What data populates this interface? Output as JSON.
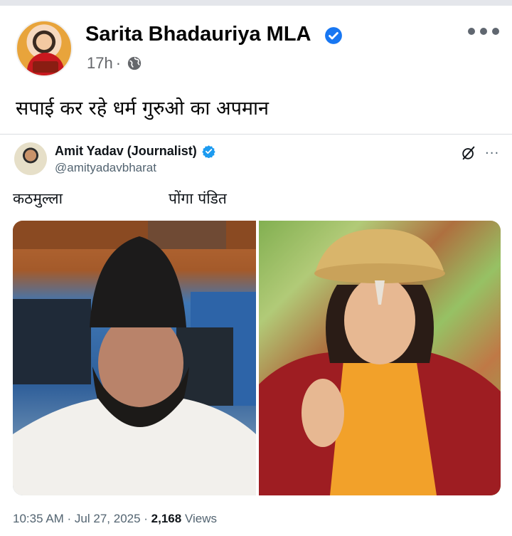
{
  "post": {
    "author_name": "Sarita Bhadauriya MLA",
    "time": "17h",
    "separator": "·",
    "audience_icon": "globe-icon",
    "text": "सपाई कर रहे धर्म गुरुओ का अपमान"
  },
  "embedded_tweet": {
    "author_name": "Amit Yadav (Journalist)",
    "handle": "@amityadavbharat",
    "label_left": "कठमुल्ला",
    "label_right": "पोंगा पंडित",
    "timestamp": "10:35 AM · Jul 27, 2025 · ",
    "views_count": "2,168",
    "views_label": " Views"
  },
  "colors": {
    "verified_blue": "#1877f2",
    "twitter_blue": "#1d9bf0",
    "secondary_text": "#65676b"
  }
}
